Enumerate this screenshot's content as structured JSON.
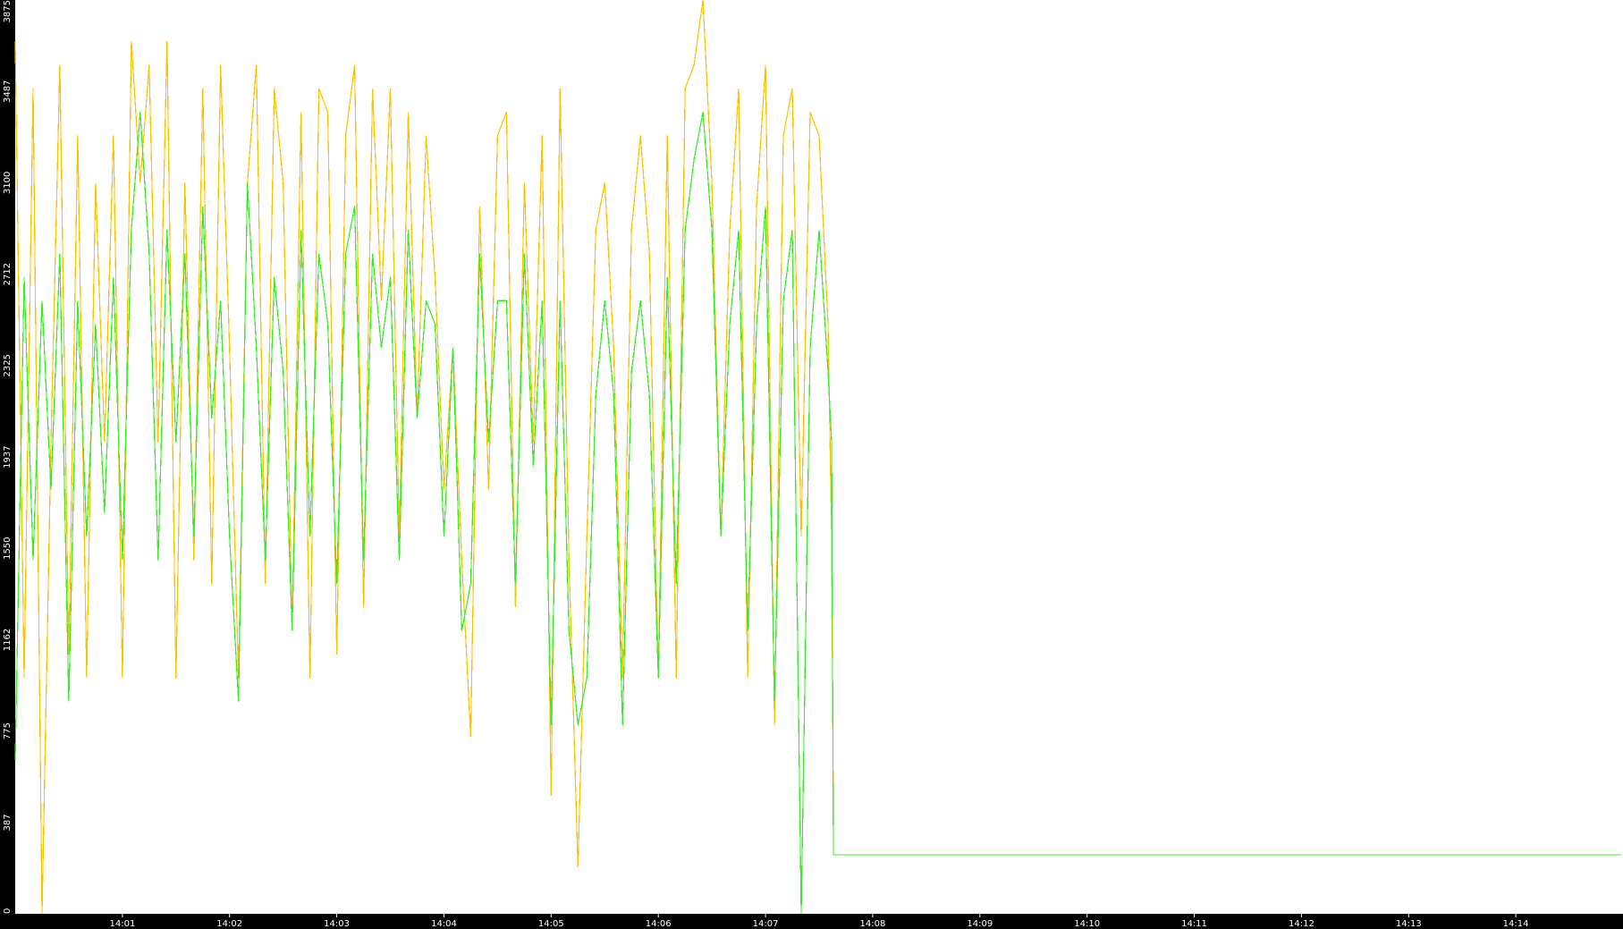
{
  "chart_data": {
    "type": "line",
    "title": "",
    "xlabel": "",
    "ylabel": "",
    "grid": false,
    "legend": "none",
    "background_color": "#000000",
    "plot_background_color": "#ffffff",
    "ylim": [
      0,
      3875
    ],
    "y_ticks": [
      "0",
      "387",
      "775",
      "1162",
      "1550",
      "1937",
      "2325",
      "2712",
      "3100",
      "3487",
      "3875"
    ],
    "xlim": [
      "14:00:00",
      "14:15:00"
    ],
    "x_ticks": [
      "14:01",
      "14:02",
      "14:03",
      "14:04",
      "14:05",
      "14:06",
      "14:07",
      "14:08",
      "14:09",
      "14:10",
      "14:11",
      "14:12",
      "14:13",
      "14:14"
    ],
    "x_tick_times": [
      "14:01:00",
      "14:02:00",
      "14:03:00",
      "14:04:00",
      "14:05:00",
      "14:06:00",
      "14:07:00",
      "14:08:00",
      "14:09:00",
      "14:10:00",
      "14:11:00",
      "14:12:00",
      "14:13:00",
      "14:14:00"
    ],
    "series": [
      {
        "color": "#ffc000",
        "x": [
          "14:00:00",
          "14:00:05",
          "14:00:10",
          "14:00:15",
          "14:00:20",
          "14:00:25",
          "14:00:30",
          "14:00:35",
          "14:00:40",
          "14:00:45",
          "14:00:50",
          "14:00:55",
          "14:01:00",
          "14:01:05",
          "14:01:10",
          "14:01:15",
          "14:01:20",
          "14:01:25",
          "14:01:30",
          "14:01:35",
          "14:01:40",
          "14:01:45",
          "14:01:50",
          "14:01:55",
          "14:02:00",
          "14:02:05",
          "14:02:10",
          "14:02:15",
          "14:02:20",
          "14:02:25",
          "14:02:30",
          "14:02:35",
          "14:02:40",
          "14:02:45",
          "14:02:50",
          "14:02:55",
          "14:03:00",
          "14:03:05",
          "14:03:10",
          "14:03:15",
          "14:03:20",
          "14:03:25",
          "14:03:30",
          "14:03:35",
          "14:03:40",
          "14:03:45",
          "14:03:50",
          "14:03:55",
          "14:04:00",
          "14:04:05",
          "14:04:10",
          "14:04:15",
          "14:04:20",
          "14:04:25",
          "14:04:30",
          "14:04:35",
          "14:04:40",
          "14:04:45",
          "14:04:50",
          "14:04:55",
          "14:05:00",
          "14:05:05",
          "14:05:10",
          "14:05:15",
          "14:05:20",
          "14:05:25",
          "14:05:30",
          "14:05:35",
          "14:05:40",
          "14:05:45",
          "14:05:50",
          "14:05:55",
          "14:06:00",
          "14:06:05",
          "14:06:10",
          "14:06:15",
          "14:06:20",
          "14:06:25",
          "14:06:30",
          "14:06:35",
          "14:06:40",
          "14:06:45",
          "14:06:50",
          "14:06:55",
          "14:07:00",
          "14:07:05",
          "14:07:10",
          "14:07:15",
          "14:07:20",
          "14:07:25",
          "14:07:30",
          "14:07:35",
          "14:07:37",
          "14:07:38"
        ],
        "y": [
          3700,
          1000,
          3500,
          0,
          2000,
          3600,
          1100,
          3300,
          1000,
          3100,
          2000,
          3300,
          1000,
          3700,
          3100,
          3600,
          2000,
          3700,
          1000,
          3100,
          1500,
          3500,
          1400,
          3600,
          2400,
          1000,
          3100,
          3600,
          1400,
          3500,
          3100,
          1200,
          3400,
          1000,
          3500,
          3400,
          1100,
          3300,
          3600,
          1300,
          3500,
          2600,
          3500,
          1600,
          3400,
          2100,
          3300,
          2700,
          1800,
          2400,
          1500,
          750,
          3000,
          1800,
          3300,
          3400,
          1300,
          3100,
          2000,
          3300,
          500,
          3500,
          1500,
          200,
          1600,
          2900,
          3100,
          2400,
          1000,
          2900,
          3300,
          2800,
          1000,
          3300,
          1000,
          3500,
          3600,
          3875,
          3100,
          1600,
          2900,
          3500,
          1000,
          3000,
          3600,
          800,
          3300,
          3500,
          1600,
          3400,
          3300,
          2500,
          1600,
          400
        ]
      },
      {
        "color": "#33ee22",
        "x": [
          "14:00:00",
          "14:00:05",
          "14:00:10",
          "14:00:15",
          "14:00:20",
          "14:00:25",
          "14:00:30",
          "14:00:35",
          "14:00:40",
          "14:00:45",
          "14:00:50",
          "14:00:55",
          "14:01:00",
          "14:01:05",
          "14:01:10",
          "14:01:15",
          "14:01:20",
          "14:01:25",
          "14:01:30",
          "14:01:35",
          "14:01:40",
          "14:01:45",
          "14:01:50",
          "14:01:55",
          "14:02:00",
          "14:02:05",
          "14:02:10",
          "14:02:15",
          "14:02:20",
          "14:02:25",
          "14:02:30",
          "14:02:35",
          "14:02:40",
          "14:02:45",
          "14:02:50",
          "14:02:55",
          "14:03:00",
          "14:03:05",
          "14:03:10",
          "14:03:15",
          "14:03:20",
          "14:03:25",
          "14:03:30",
          "14:03:35",
          "14:03:40",
          "14:03:45",
          "14:03:50",
          "14:03:55",
          "14:04:00",
          "14:04:05",
          "14:04:10",
          "14:04:15",
          "14:04:20",
          "14:04:25",
          "14:04:30",
          "14:04:35",
          "14:04:40",
          "14:04:45",
          "14:04:50",
          "14:04:55",
          "14:05:00",
          "14:05:05",
          "14:05:10",
          "14:05:15",
          "14:05:20",
          "14:05:25",
          "14:05:30",
          "14:05:35",
          "14:05:40",
          "14:05:45",
          "14:05:50",
          "14:05:55",
          "14:06:00",
          "14:06:05",
          "14:06:10",
          "14:06:15",
          "14:06:20",
          "14:06:25",
          "14:06:30",
          "14:06:35",
          "14:06:40",
          "14:06:45",
          "14:06:50",
          "14:06:55",
          "14:07:00",
          "14:07:05",
          "14:07:10",
          "14:07:15",
          "14:07:20",
          "14:07:25",
          "14:07:30",
          "14:07:35",
          "14:07:37",
          "14:07:38",
          "14:08:00",
          "14:09:00",
          "14:10:00",
          "14:11:00",
          "14:12:00",
          "14:13:00",
          "14:14:00",
          "14:14:59"
        ],
        "y": [
          650,
          2700,
          1500,
          2600,
          1800,
          2800,
          900,
          2600,
          1600,
          2500,
          1700,
          2700,
          1500,
          2900,
          3400,
          2800,
          1500,
          2900,
          2000,
          2800,
          1600,
          3000,
          2100,
          2600,
          1600,
          900,
          3100,
          2400,
          1500,
          2700,
          2300,
          1200,
          2900,
          1600,
          2800,
          2500,
          1400,
          2800,
          3000,
          1500,
          2800,
          2400,
          2700,
          1500,
          2900,
          2100,
          2600,
          2500,
          1600,
          2400,
          1200,
          1400,
          2800,
          2000,
          2600,
          2600,
          1400,
          2800,
          1900,
          2600,
          800,
          2600,
          1200,
          800,
          1000,
          2200,
          2600,
          2200,
          800,
          2300,
          2600,
          2200,
          1000,
          2700,
          1400,
          2900,
          3200,
          3400,
          2900,
          1600,
          2500,
          2900,
          1200,
          2500,
          3000,
          900,
          2600,
          2900,
          0,
          2400,
          2900,
          2300,
          2000,
          250,
          250,
          250,
          250,
          250,
          250,
          250,
          250,
          250
        ]
      }
    ]
  }
}
